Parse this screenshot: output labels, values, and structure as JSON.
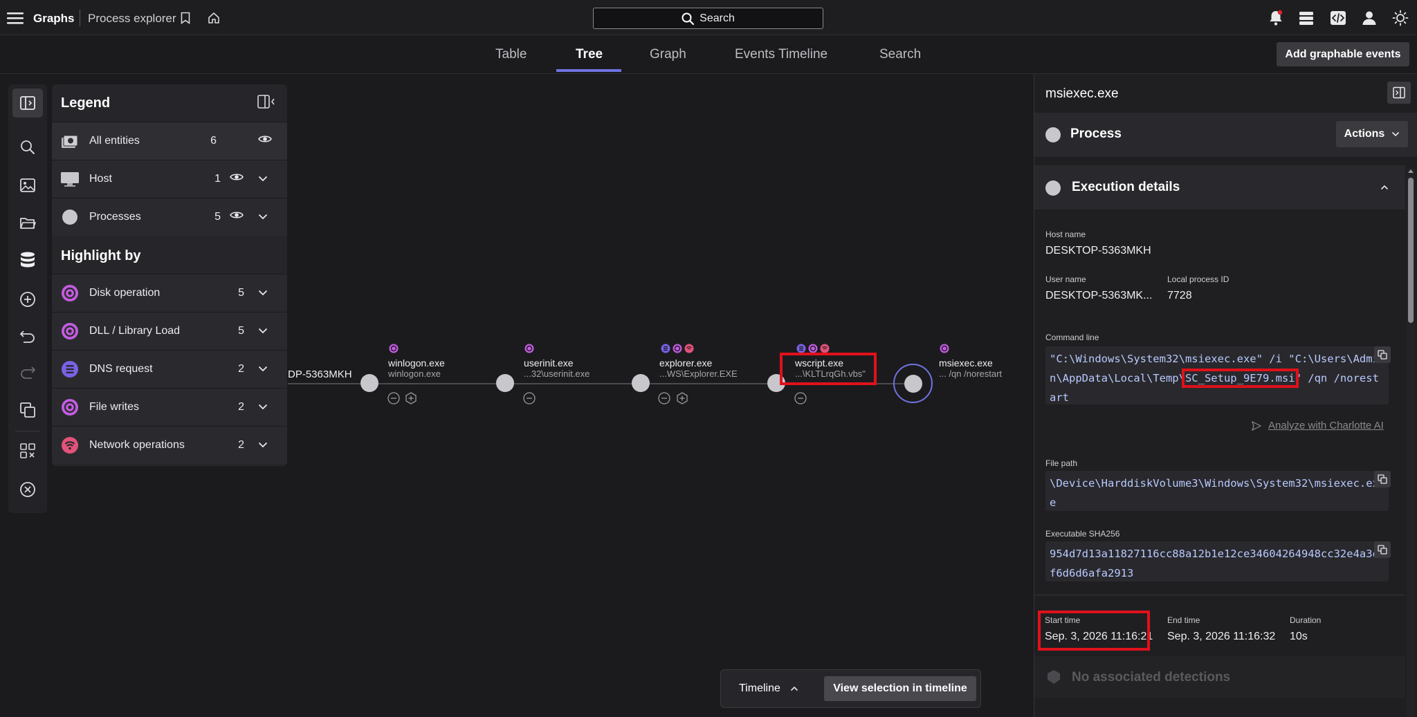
{
  "topbar": {
    "app_title": "Graphs",
    "page_title": "Process explorer",
    "search_label": "Search"
  },
  "tabs": [
    {
      "label": "Table"
    },
    {
      "label": "Tree"
    },
    {
      "label": "Graph"
    },
    {
      "label": "Events Timeline"
    },
    {
      "label": "Search"
    }
  ],
  "add_graphable_label": "Add graphable events",
  "legend": {
    "title": "Legend",
    "entities": [
      {
        "label": "All entities",
        "count": "6"
      },
      {
        "label": "Host",
        "count": "1"
      },
      {
        "label": "Processes",
        "count": "5"
      }
    ],
    "highlight_title": "Highlight by",
    "highlights": [
      {
        "label": "Disk operation",
        "count": "5",
        "color": "#c35ce0"
      },
      {
        "label": "DLL / Library Load",
        "count": "5",
        "color": "#c35ce0"
      },
      {
        "label": "DNS request",
        "count": "2",
        "color": "#7a62e6"
      },
      {
        "label": "File writes",
        "count": "2",
        "color": "#c35ce0"
      },
      {
        "label": "Network operations",
        "count": "2",
        "color": "#e2527a"
      }
    ]
  },
  "tree": {
    "host_label": "DP-5363MKH",
    "nodes": [
      {
        "name": "winlogon.exe",
        "sub": "winlogon.exe"
      },
      {
        "name": "userinit.exe",
        "sub": "...32\\userinit.exe"
      },
      {
        "name": "explorer.exe",
        "sub": "...WS\\Explorer.EXE"
      },
      {
        "name": "wscript.exe",
        "sub": "...\\KLTLrqGh.vbs\""
      },
      {
        "name": "msiexec.exe",
        "sub": "... /qn /norestart"
      }
    ]
  },
  "panel": {
    "title": "msiexec.exe",
    "section_process": "Process",
    "actions_label": "Actions",
    "section_exec": "Execution details",
    "host_name_label": "Host name",
    "host_name": "DESKTOP-5363MKH",
    "user_name_label": "User name",
    "user_name": "DESKTOP-5363MK...",
    "pid_label": "Local process ID",
    "pid": "7728",
    "cmdline_label": "Command line",
    "cmdline_part1": "\"C:\\Windows\\System32\\msiexec.exe\" /i \"C:\\Users\\Admin\\AppData\\Local\\Temp\\",
    "cmdline_highlight": "SC_Setup_9E79.msi",
    "cmdline_part2": "\" /qn /norestart",
    "analyze_label": "Analyze with Charlotte AI",
    "filepath_label": "File path",
    "filepath": "\\Device\\HarddiskVolume3\\Windows\\System32\\msiexec.exe",
    "sha_label": "Executable SHA256",
    "sha": "954d7d13a11827116cc88a12b1e12ce34604264948cc32e4a3ef6d6d6afa2913",
    "start_label": "Start time",
    "start": "Sep. 3, 2026 11:16:21",
    "end_label": "End time",
    "end": "Sep. 3, 2026 11:16:32",
    "duration_label": "Duration",
    "duration": "10s",
    "detections_label": "No associated detections"
  },
  "timeline": {
    "label": "Timeline",
    "view_button": "View selection in timeline"
  },
  "colors": {
    "accent": "#6f73e0",
    "highlight_box": "#e0111b",
    "disk": "#c35ce0",
    "dns": "#7a62e6",
    "network": "#e2527a"
  }
}
